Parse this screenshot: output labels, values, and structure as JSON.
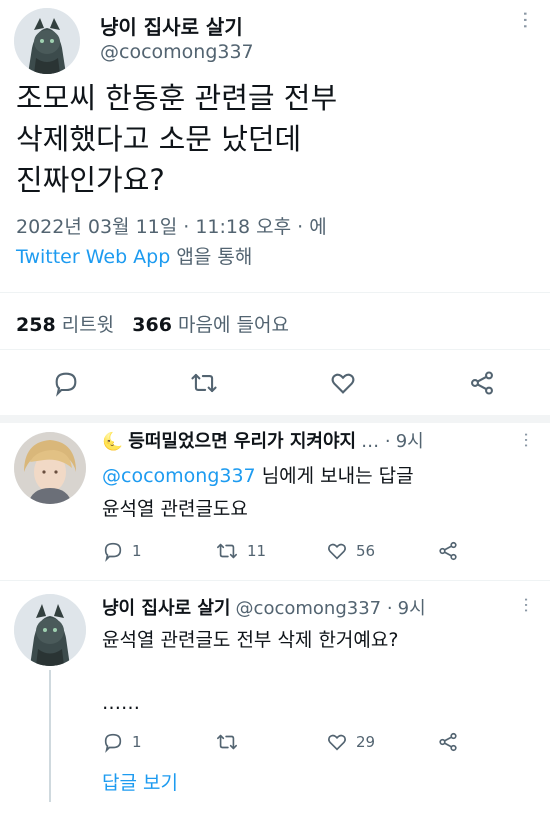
{
  "main_tweet": {
    "author_name": "냥이 집사로 살기",
    "author_handle": "@cocomong337",
    "text_line1": "조모씨  한동훈 관련글 전부",
    "text_line2": "삭제했다고 소문 났던데",
    "text_line3": "진짜인가요?",
    "timestamp": "2022년 03월 11일 · 11:18 오후 · 에",
    "source_app": "Twitter Web App",
    "source_suffix": "앱을 통해",
    "retweets_count": "258",
    "retweets_label": "리트윗",
    "likes_count": "366",
    "likes_label": "마음에 들어요"
  },
  "replies": [
    {
      "author_name": "등떠밀었으면 우리가 지켜야지",
      "emoji": "🌜",
      "trail": "… ·",
      "time": "9시",
      "replying_mention": "@cocomong337",
      "replying_suffix": "님에게 보내는 답글",
      "text": "윤석열 관련글도요",
      "reply_count": "1",
      "retweet_count": "11",
      "like_count": "56"
    },
    {
      "author_name": "냥이 집사로 살기",
      "author_handle": "@cocomong337 ·",
      "time": "9시",
      "text": "윤석열 관련글도  전부 삭제 한거예요?",
      "text2": "……",
      "reply_count": "1",
      "retweet_count": "",
      "like_count": "29"
    }
  ],
  "show_replies_label": "답글 보기",
  "colors": {
    "accent": "#1d9bf0",
    "secondary_text": "#536471",
    "divider": "#eff3f4"
  },
  "icons": [
    "more-icon",
    "reply-icon",
    "retweet-icon",
    "like-icon",
    "share-icon"
  ]
}
